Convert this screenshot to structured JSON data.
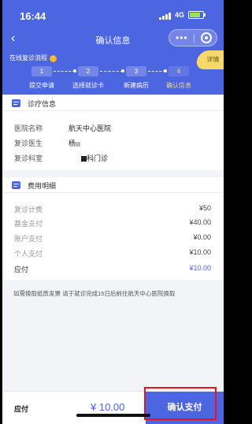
{
  "status_bar": {
    "time": "16:44",
    "network": "4G"
  },
  "nav": {
    "back_icon": "‹",
    "title": "确认信息",
    "more_icon": "•••"
  },
  "flow": {
    "title": "在线复诊流程",
    "info_icon": "!",
    "detail_label": "详情"
  },
  "steps": [
    {
      "number": "1",
      "label": "提交申请",
      "active": false
    },
    {
      "number": "2",
      "label": "选择就诊卡",
      "active": false
    },
    {
      "number": "3",
      "label": "新建病历",
      "active": false
    },
    {
      "number": "4",
      "label": "确认信息",
      "active": true
    }
  ],
  "medical_info": {
    "title": "诊疗信息",
    "rows": [
      {
        "label": "医院名称",
        "value": "航天中心医院"
      },
      {
        "label": "复诊医生",
        "value": "杨"
      },
      {
        "label": "复诊科室",
        "value": "科门诊"
      }
    ]
  },
  "fee_detail": {
    "title": "费用明细",
    "rows": [
      {
        "label": "复诊计费",
        "value": "¥50"
      },
      {
        "label": "基金支付",
        "value": "¥40.00"
      },
      {
        "label": "账户支付",
        "value": "¥0.00"
      },
      {
        "label": "个人支付",
        "value": "¥10.00"
      },
      {
        "label": "应付",
        "value": "¥10.00"
      }
    ]
  },
  "notice": "如需换取纸质发票 请于就诊完成15日后前往航天中心医院换取",
  "bottom": {
    "pay_label": "应付",
    "amount": "¥ 10.00",
    "button_label": "确认支付"
  },
  "colors": {
    "brand": "#4c65e0",
    "highlight": "#e8141c",
    "badge": "#f7d86a"
  }
}
